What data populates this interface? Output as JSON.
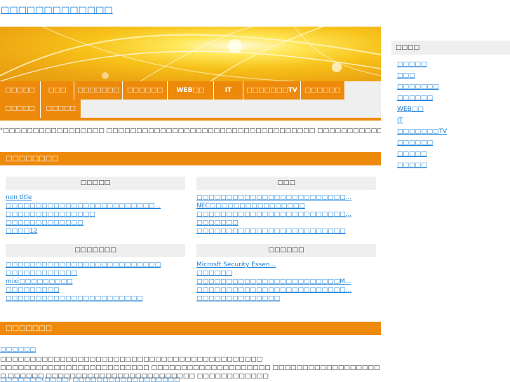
{
  "site": {
    "title": "□□□□□□□□□□□□□"
  },
  "nav": {
    "row1": [
      "□□□□□",
      "□□□",
      "□□□□□□□",
      "□□□□□□",
      "WEB□□",
      "IT",
      "□□□□□□□TV",
      "□□□□□□"
    ],
    "row2": [
      "□□□□□",
      "□□□□□"
    ]
  },
  "intro": "\"□□□□□□□□□□□□□□□□□ □□□□□□□□□□□□□□□□□□□□□□□□□□□□□□□□□□□ □□□□□□□□□□□□□□□□□□□□□□□□□□\"",
  "sections": {
    "categories_title": "□□□□□□□□",
    "posts_title": "□□□□□□□"
  },
  "categories": [
    {
      "name": "□□□□□",
      "items": [
        "non title",
        "□□□□□□□□□□□□□□□□□□□□□□□□□...",
        "□□□□□□□□□□□□□□□",
        "□□□□□□□□□□□□□",
        "□□□□12"
      ]
    },
    {
      "name": "□□□",
      "items": [
        "□□□□□□□□□□□□□□□□□□□□□□□□□...",
        "NEC□□□□□□□□□□□□□□□□",
        "□□□□□□□□□□□□□□□□□□□□□□□□□...",
        "□□□□□□□",
        "□□□□□□□□□□□□□□□□□□□□□□□□□"
      ]
    },
    {
      "name": "□□□□□□□",
      "items": [
        "□□□□□□□□□□□□□□□□□□□□□□□□□□",
        "□□□□□□□□□□□□",
        "mixi□□□□□□□□□",
        "□□□□□□□□□",
        "□□□□□□□□□□□□□□□□□□□□□□□"
      ]
    },
    {
      "name": "□□□□□□",
      "items": [
        "Microsft Security Essen...",
        "□□□□□□",
        "□□□□□□□□□□□□□□□□□□□□□□□□M...",
        "□□□□□□□□□□□□□□□□□□□□□□□□□...",
        "□□□□□□□□□□□□□□"
      ]
    }
  ],
  "post": {
    "title": "□□□□□□",
    "body": "□□□□□□□□□□□□□□□□□□□□□□□□□□□□□□□□□□□□□□□□□□□□ □□□□□□□□□□□□□□□□□□□□□□□□□ □□□□□□□□□□□□□□□□□□□□ □□□□□□□□□□□□□□□□□□ □ □□□□□□ □□□□□□□□□□□□□□□□□□□□□□□□□ □□□□□□□□□□□□",
    "more": "□□□□□□□(□□□□)  □□□□□□□□□□□□□□□□□□"
  },
  "sidebar": {
    "title": "□□□□",
    "items": [
      "□□□□□",
      "□□□",
      "□□□□□□□",
      "□□□□□□",
      "WEB□□",
      "IT",
      "□□□□□□□TV",
      "□□□□□□",
      "□□□□□",
      "□□□□□"
    ]
  },
  "colors": {
    "accent": "#ee8a0b",
    "link": "#1a7fd6",
    "panel": "#efefef"
  }
}
